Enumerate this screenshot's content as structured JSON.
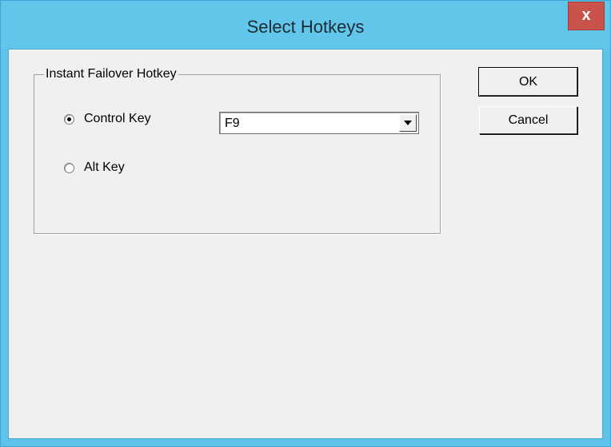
{
  "window": {
    "title": "Select Hotkeys",
    "close_label": "x"
  },
  "group": {
    "legend": "Instant Failover Hotkey",
    "options": [
      {
        "label": "Control Key",
        "selected": true
      },
      {
        "label": "Alt Key",
        "selected": false
      }
    ],
    "key_combo": {
      "value": "F9"
    }
  },
  "buttons": {
    "ok_label": "OK",
    "cancel_label": "Cancel"
  },
  "colors": {
    "titlebar": "#62c6ea",
    "close": "#c9534b",
    "client": "#f0f0f0"
  },
  "icons": {
    "combo_arrow": "chevron-down-icon",
    "close": "close-icon"
  }
}
